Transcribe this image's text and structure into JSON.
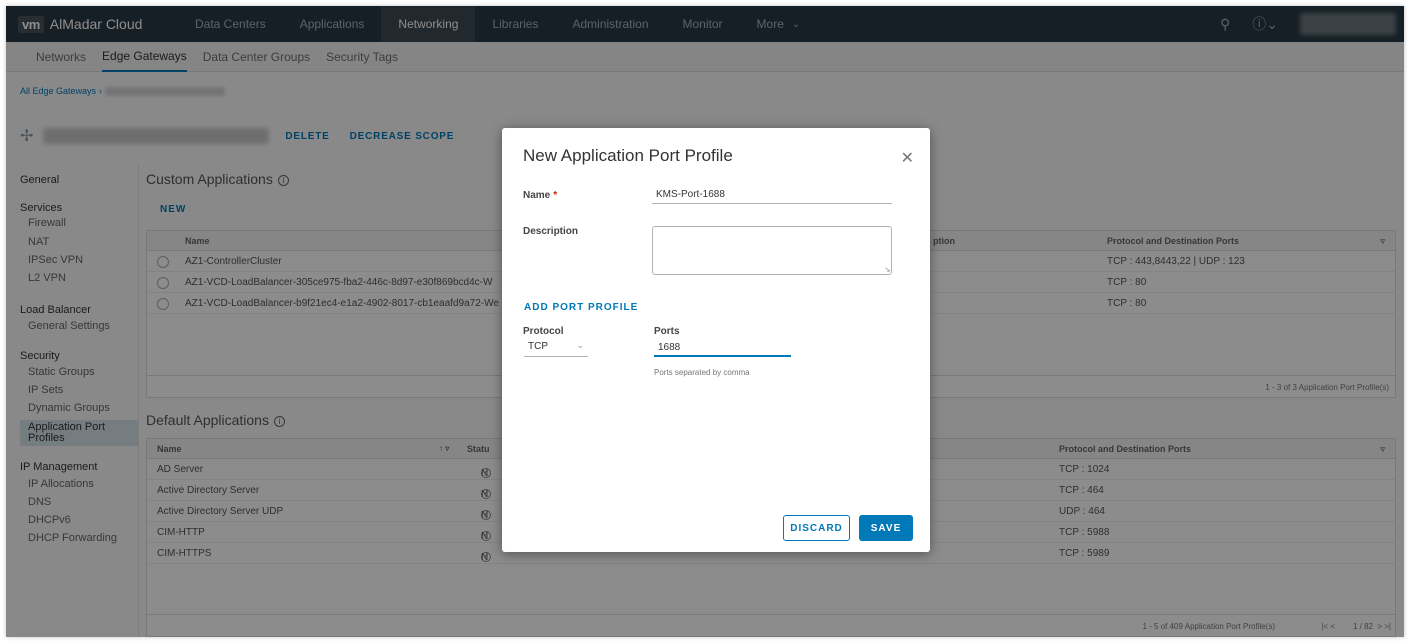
{
  "header": {
    "logo": "vm",
    "brand": "AlMadar Cloud",
    "nav": [
      "Data Centers",
      "Applications",
      "Networking",
      "Libraries",
      "Administration",
      "Monitor",
      "More"
    ],
    "active_nav": "Networking",
    "search_icon": "search-icon",
    "help_icon": "help-icon"
  },
  "subnav": {
    "items": [
      "Networks",
      "Edge Gateways",
      "Data Center Groups",
      "Security Tags"
    ],
    "active": "Edge Gateways"
  },
  "breadcrumb": {
    "root": "All Edge Gateways",
    "sep": "›"
  },
  "page": {
    "actions": [
      "DELETE",
      "DECREASE SCOPE"
    ]
  },
  "leftnav": {
    "general": "General",
    "services": "Services",
    "firewall": "Firewall",
    "nat": "NAT",
    "ipsec": "IPSec VPN",
    "l2vpn": "L2 VPN",
    "lb": "Load Balancer",
    "lb_settings": "General Settings",
    "security": "Security",
    "static_groups": "Static Groups",
    "ip_sets": "IP Sets",
    "dynamic_groups": "Dynamic Groups",
    "app_port_profiles": "Application Port Profiles",
    "ip_mgmt": "IP Management",
    "ip_alloc": "IP Allocations",
    "dns": "DNS",
    "dhcpv6": "DHCPv6",
    "dhcp_fwd": "DHCP Forwarding"
  },
  "custom_apps": {
    "title": "Custom Applications",
    "new_label": "NEW",
    "col_name": "Name",
    "col_desc": "ption",
    "col_ports": "Protocol and Destination Ports",
    "rows": [
      {
        "name": "AZ1-ControllerCluster",
        "ports": "TCP : 443,8443,22 | UDP : 123"
      },
      {
        "name": "AZ1-VCD-LoadBalancer-305ce975-fba2-446c-8d97-e30f869bcd4c-W",
        "ports": "TCP : 80"
      },
      {
        "name": "AZ1-VCD-LoadBalancer-b9f21ec4-e1a2-4902-8017-cb1eaafd9a72-We",
        "ports": "TCP : 80"
      }
    ],
    "footer": "1 - 3 of 3 Application Port Profile(s)"
  },
  "default_apps": {
    "title": "Default Applications",
    "col_name": "Name",
    "col_status": "Statu",
    "col_ports": "Protocol and Destination Ports",
    "rows": [
      {
        "name": "AD Server",
        "status": "N",
        "ports": "TCP : 1024"
      },
      {
        "name": "Active Directory Server",
        "status": "N",
        "ports": "TCP : 464"
      },
      {
        "name": "Active Directory Server UDP",
        "status": "N",
        "ports": "UDP : 464"
      },
      {
        "name": "CIM-HTTP",
        "status": "N",
        "ports": "TCP : 5988"
      },
      {
        "name": "CIM-HTTPS",
        "status": "N",
        "ports": "TCP : 5989"
      }
    ],
    "footer": "1 - 5 of 409 Application Port Profile(s)",
    "pager": "1 / 82"
  },
  "modal": {
    "title": "New Application Port Profile",
    "name_label": "Name",
    "name_required": "*",
    "name_value": "KMS-Port-1688",
    "desc_label": "Description",
    "desc_value": "",
    "add_port_profile": "ADD PORT PROFILE",
    "protocol_label": "Protocol",
    "protocol_value": "TCP",
    "ports_label": "Ports",
    "ports_value": "1688",
    "ports_helper": "Ports separated by comma",
    "discard": "DISCARD",
    "save": "SAVE"
  },
  "colors": {
    "header_bg": "#2b3a45",
    "accent": "#0079b8",
    "required": "#c92100"
  }
}
